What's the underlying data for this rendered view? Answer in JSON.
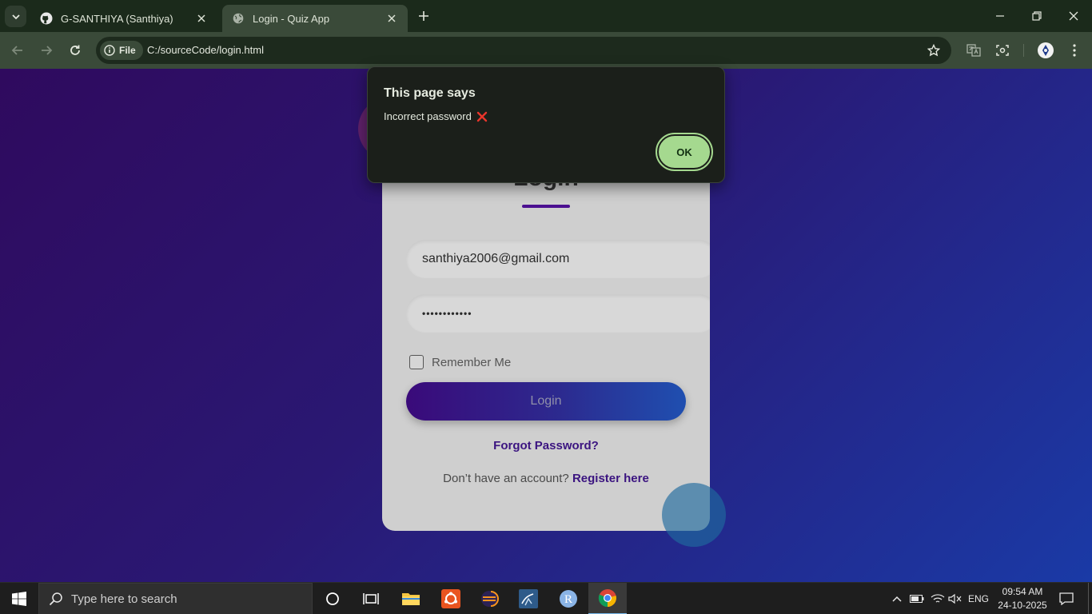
{
  "browser": {
    "tabs": [
      {
        "title": "G-SANTHIYA (Santhiya)",
        "icon": "github-icon",
        "active": false
      },
      {
        "title": "Login - Quiz App",
        "icon": "globe-icon",
        "active": true
      }
    ],
    "address_chip": "File",
    "url": "C:/sourceCode/login.html"
  },
  "page": {
    "title": "Login",
    "email_value": "santhiya2006@gmail.com",
    "password_value": "••••••••••••",
    "remember_label": "Remember Me",
    "login_button": "Login",
    "forgot_link": "Forgot Password?",
    "register_prompt": "Don’t have an account?",
    "register_link": "Register here"
  },
  "dialog": {
    "title": "This page says",
    "message": "Incorrect password",
    "message_icon": "red-x-icon",
    "ok_button": "OK"
  },
  "taskbar": {
    "search_placeholder": "Type here to search",
    "language": "ENG",
    "time": "09:54 AM",
    "date": "24-10-2025"
  },
  "colors": {
    "browser_frame": "#1b2a1b",
    "toolbar": "#3a4a39",
    "dialog_bg": "#1b1f1a",
    "ok_button": "#a5d98f",
    "brand_purple": "#4b0f90",
    "page_gradient_start": "#2f0a5e",
    "page_gradient_end": "#1a3aa6"
  }
}
